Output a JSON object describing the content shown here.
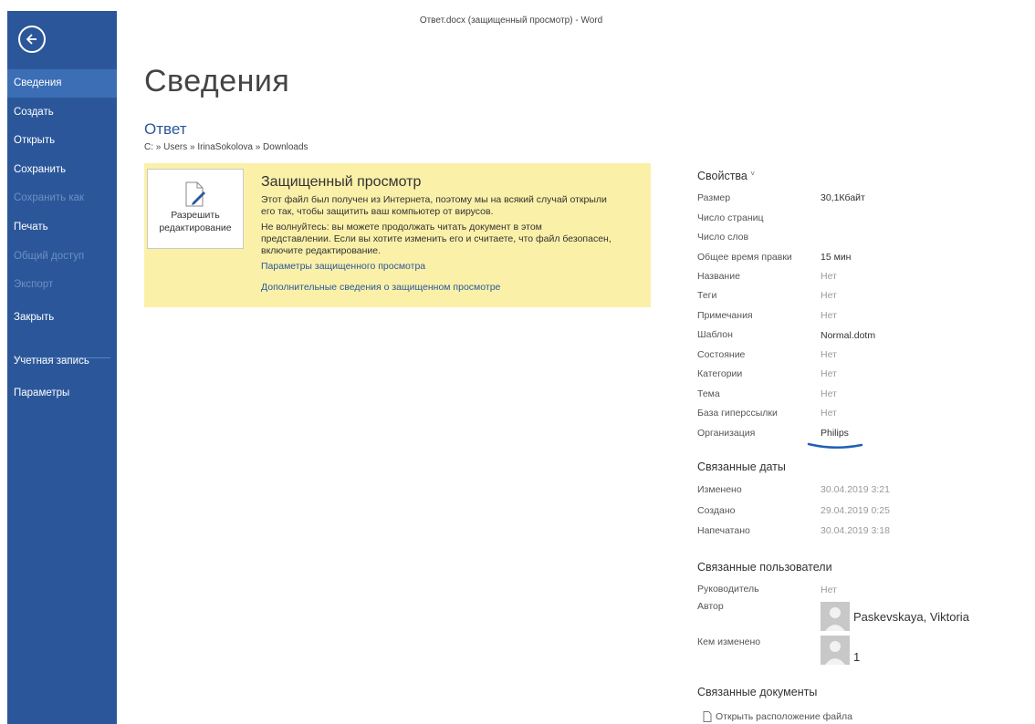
{
  "window": {
    "title": "Ответ.docx (защищенный просмотр) - Word"
  },
  "sidebar": {
    "items": [
      {
        "label": "Сведения",
        "state": "active"
      },
      {
        "label": "Создать",
        "state": "normal"
      },
      {
        "label": "Открыть",
        "state": "normal"
      },
      {
        "label": "Сохранить",
        "state": "normal"
      },
      {
        "label": "Сохранить как",
        "state": "disabled"
      },
      {
        "label": "Печать",
        "state": "normal"
      },
      {
        "label": "Общий доступ",
        "state": "disabled"
      },
      {
        "label": "Экспорт",
        "state": "disabled"
      },
      {
        "label": "Закрыть",
        "state": "normal"
      },
      {
        "label": "Учетная запись",
        "state": "normal"
      },
      {
        "label": "Параметры",
        "state": "normal"
      }
    ]
  },
  "main": {
    "page_title": "Сведения",
    "doc_name": "Ответ",
    "doc_path": "C: » Users » IrinaSokolova » Downloads"
  },
  "protected_view": {
    "button_label_1": "Разрешить",
    "button_label_2": "редактирование",
    "title": "Защищенный просмотр",
    "line1": "Этот файл был получен из Интернета, поэтому мы на всякий случай открыли",
    "line2": "его так, чтобы защитить ваш компьютер от вирусов.",
    "line3": "Не волнуйтесь: вы можете продолжать читать документ в этом",
    "line4": "представлении. Если вы хотите изменить его и считаете, что файл безопасен,",
    "line5": "включите редактирование.",
    "link1": "Параметры защищенного просмотра",
    "link2": "Дополнительные сведения о защищенном просмотре"
  },
  "properties": {
    "heading": "Свойства",
    "caret": "˅",
    "size_label": "Размер",
    "size_value": "30,1Кбайт",
    "pages_label": "Число страниц",
    "words_label": "Число слов",
    "edit_time_label": "Общее время правки",
    "edit_time_value": "15 мин",
    "title_label": "Название",
    "title_value": "Нет",
    "tags_label": "Теги",
    "tags_value": "Нет",
    "comments_label": "Примечания",
    "comments_value": "Нет",
    "template_label": "Шаблон",
    "template_value": "Normal.dotm",
    "status_label": "Состояние",
    "status_value": "Нет",
    "categories_label": "Категории",
    "categories_value": "Нет",
    "subject_label": "Тема",
    "subject_value": "Нет",
    "hyperlink_label": "База гиперссылки",
    "hyperlink_value": "Нет",
    "company_label": "Организация",
    "company_value": "Philips"
  },
  "dates": {
    "heading": "Связанные даты",
    "modified_label": "Изменено",
    "modified_value": "30.04.2019 3:21",
    "created_label": "Создано",
    "created_value": "29.04.2019 0:25",
    "printed_label": "Напечатано",
    "printed_value": "30.04.2019 3:18"
  },
  "people": {
    "heading": "Связанные пользователи",
    "manager_label": "Руководитель",
    "manager_value": "Нет",
    "author_label": "Автор",
    "author_value": "Paskevskaya, Viktoria",
    "modified_by_label": "Кем изменено",
    "modified_by_value": "1"
  },
  "documents": {
    "heading": "Связанные документы",
    "open_location": "Открыть расположение файла"
  },
  "colors": {
    "sidebar": "#2b579a",
    "accent": "#2b579a",
    "banner": "#faf0a8",
    "annotation": "#1f5fb5"
  }
}
